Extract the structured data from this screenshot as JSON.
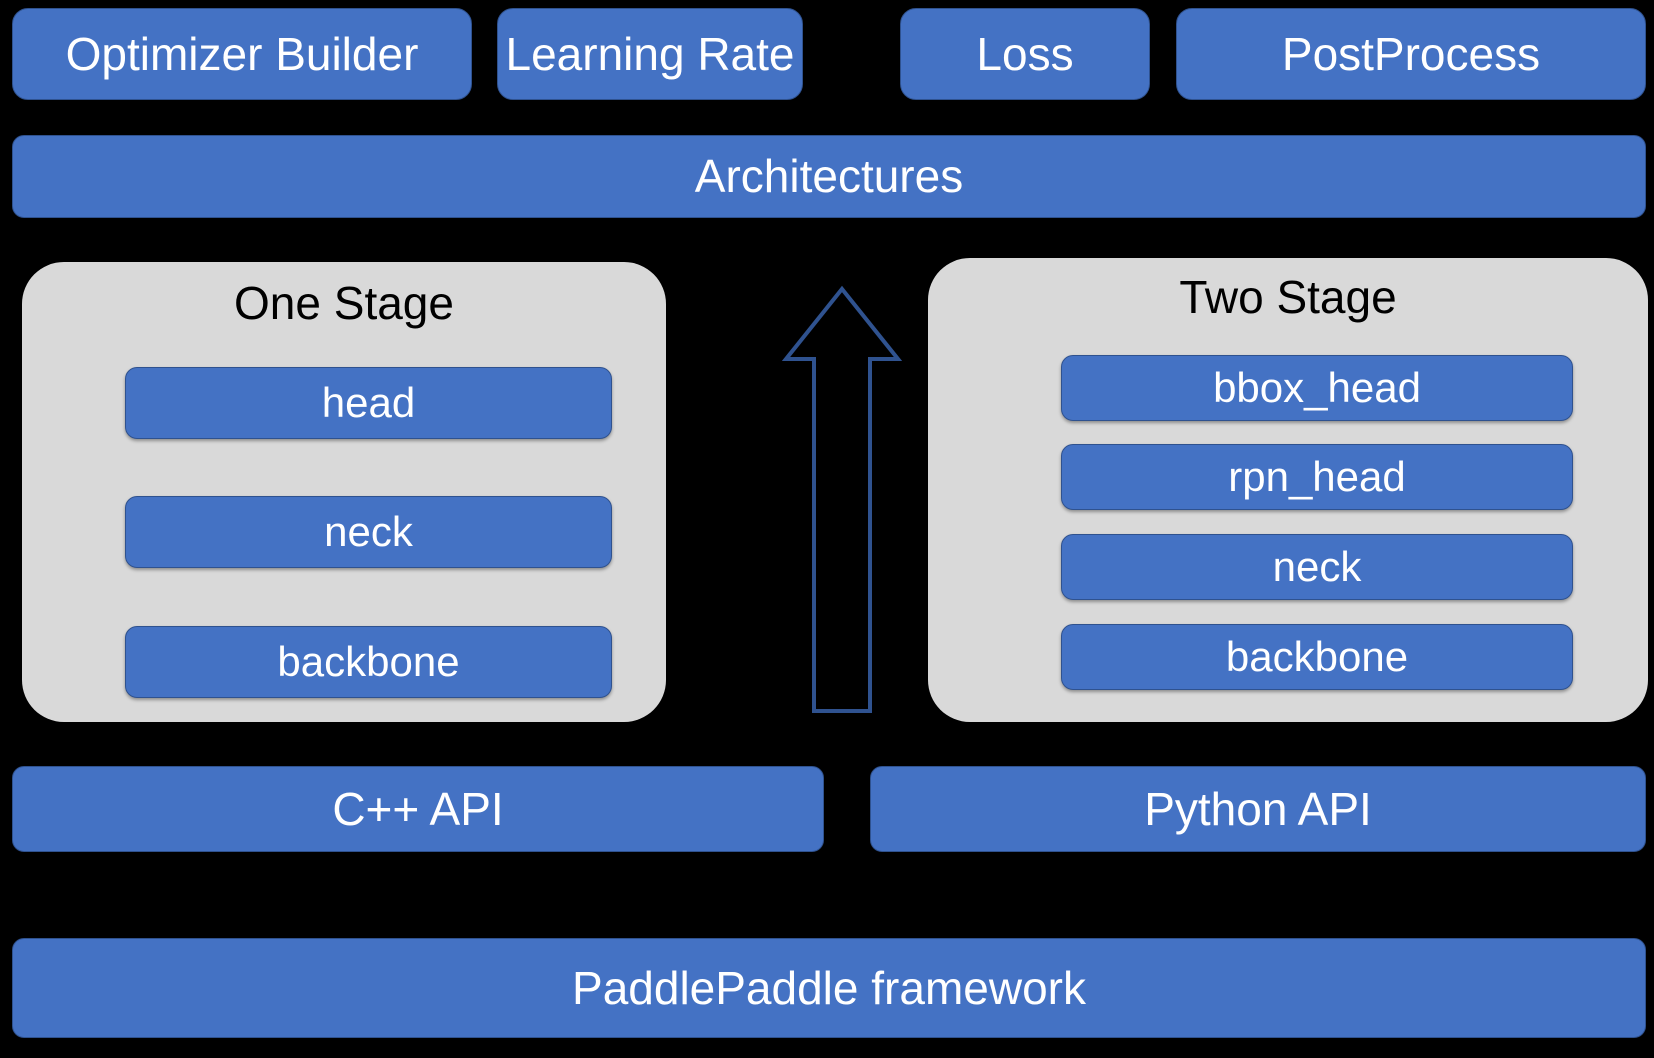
{
  "diagram": {
    "title": "PaddleDetection modular architecture stack",
    "colors": {
      "module_blue": "#4472C4",
      "module_blue_border": "#2F528F",
      "panel_gray": "#D9D9D9",
      "background": "#000000",
      "text_on_blue": "#FFFFFF",
      "panel_title_text": "#000000",
      "arrow_stroke": "#2F528F"
    },
    "top_row": [
      {
        "label": "Optimizer Builder"
      },
      {
        "label": "Learning Rate"
      },
      {
        "label": "Loss"
      },
      {
        "label": "PostProcess"
      }
    ],
    "architectures_bar": {
      "label": "Architectures"
    },
    "stages": [
      {
        "title": "One Stage",
        "modules": [
          {
            "label": "head"
          },
          {
            "label": "neck"
          },
          {
            "label": "backbone"
          }
        ]
      },
      {
        "title": "Two Stage",
        "modules": [
          {
            "label": "bbox_head"
          },
          {
            "label": "rpn_head"
          },
          {
            "label": "neck"
          },
          {
            "label": "backbone"
          }
        ]
      }
    ],
    "arrow": {
      "name": "up-arrow-icon",
      "direction": "up"
    },
    "api_bars": [
      {
        "label": "C++ API"
      },
      {
        "label": "Python API"
      }
    ],
    "framework_bar": {
      "label": "PaddlePaddle framework"
    }
  }
}
